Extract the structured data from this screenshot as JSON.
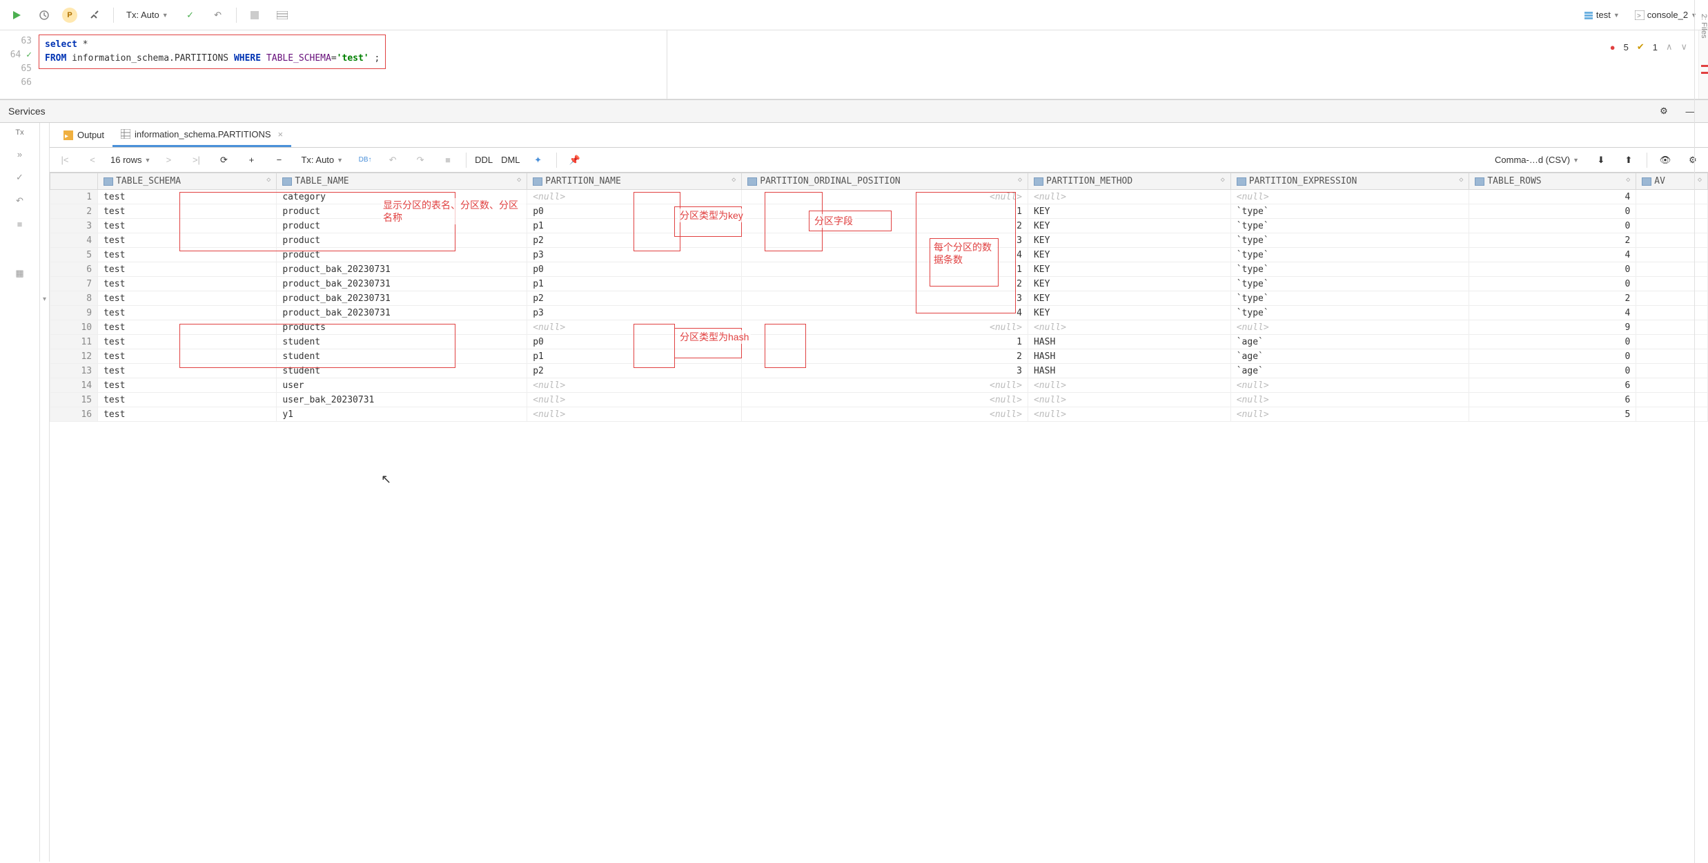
{
  "toolbar": {
    "tx_mode": "Tx: Auto",
    "schema": "test",
    "console": "console_2"
  },
  "editor": {
    "lines": [
      "63",
      "64",
      "65",
      "66"
    ],
    "sql_select": "select",
    "sql_star": " *",
    "sql_from": "FROM",
    "sql_ident": " information_schema.PARTITIONS ",
    "sql_where": "WHERE",
    "sql_col": " TABLE_SCHEMA",
    "sql_eq": "=",
    "sql_str": "'test'",
    "sql_end": " ;"
  },
  "errors": {
    "err_count": "5",
    "warn_count": "1"
  },
  "services": {
    "title": "Services"
  },
  "tabs": {
    "output": "Output",
    "result": "information_schema.PARTITIONS"
  },
  "results_bar": {
    "rows": "16 rows",
    "tx": "Tx: Auto",
    "ddl": "DDL",
    "dml": "DML",
    "export": "Comma-…d (CSV)"
  },
  "columns": [
    "TABLE_SCHEMA",
    "TABLE_NAME",
    "PARTITION_NAME",
    "PARTITION_ORDINAL_POSITION",
    "PARTITION_METHOD",
    "PARTITION_EXPRESSION",
    "TABLE_ROWS",
    "AV"
  ],
  "rows": [
    {
      "n": 1,
      "schema": "test",
      "name": "category",
      "pname": null,
      "ord": null,
      "method": null,
      "expr": null,
      "rows": 4
    },
    {
      "n": 2,
      "schema": "test",
      "name": "product",
      "pname": "p0",
      "ord": 1,
      "method": "KEY",
      "expr": "`type`",
      "rows": 0
    },
    {
      "n": 3,
      "schema": "test",
      "name": "product",
      "pname": "p1",
      "ord": 2,
      "method": "KEY",
      "expr": "`type`",
      "rows": 0
    },
    {
      "n": 4,
      "schema": "test",
      "name": "product",
      "pname": "p2",
      "ord": 3,
      "method": "KEY",
      "expr": "`type`",
      "rows": 2
    },
    {
      "n": 5,
      "schema": "test",
      "name": "product",
      "pname": "p3",
      "ord": 4,
      "method": "KEY",
      "expr": "`type`",
      "rows": 4
    },
    {
      "n": 6,
      "schema": "test",
      "name": "product_bak_20230731",
      "pname": "p0",
      "ord": 1,
      "method": "KEY",
      "expr": "`type`",
      "rows": 0
    },
    {
      "n": 7,
      "schema": "test",
      "name": "product_bak_20230731",
      "pname": "p1",
      "ord": 2,
      "method": "KEY",
      "expr": "`type`",
      "rows": 0
    },
    {
      "n": 8,
      "schema": "test",
      "name": "product_bak_20230731",
      "pname": "p2",
      "ord": 3,
      "method": "KEY",
      "expr": "`type`",
      "rows": 2
    },
    {
      "n": 9,
      "schema": "test",
      "name": "product_bak_20230731",
      "pname": "p3",
      "ord": 4,
      "method": "KEY",
      "expr": "`type`",
      "rows": 4
    },
    {
      "n": 10,
      "schema": "test",
      "name": "products",
      "pname": null,
      "ord": null,
      "method": null,
      "expr": null,
      "rows": 9
    },
    {
      "n": 11,
      "schema": "test",
      "name": "student",
      "pname": "p0",
      "ord": 1,
      "method": "HASH",
      "expr": "`age`",
      "rows": 0
    },
    {
      "n": 12,
      "schema": "test",
      "name": "student",
      "pname": "p1",
      "ord": 2,
      "method": "HASH",
      "expr": "`age`",
      "rows": 0
    },
    {
      "n": 13,
      "schema": "test",
      "name": "student",
      "pname": "p2",
      "ord": 3,
      "method": "HASH",
      "expr": "`age`",
      "rows": 0
    },
    {
      "n": 14,
      "schema": "test",
      "name": "user",
      "pname": null,
      "ord": null,
      "method": null,
      "expr": null,
      "rows": 6
    },
    {
      "n": 15,
      "schema": "test",
      "name": "user_bak_20230731",
      "pname": null,
      "ord": null,
      "method": null,
      "expr": null,
      "rows": 6
    },
    {
      "n": 16,
      "schema": "test",
      "name": "y1",
      "pname": null,
      "ord": null,
      "method": null,
      "expr": null,
      "rows": 5
    }
  ],
  "annotations": {
    "a1": "显示分区的表名、分区数、分区名称",
    "a2": "分区类型为key",
    "a3": "分区字段",
    "a4": "每个分区的数据条数",
    "a5": "分区类型为hash"
  },
  "sidebar": {
    "files": "2: Files"
  },
  "left": {
    "tx": "Tx"
  }
}
